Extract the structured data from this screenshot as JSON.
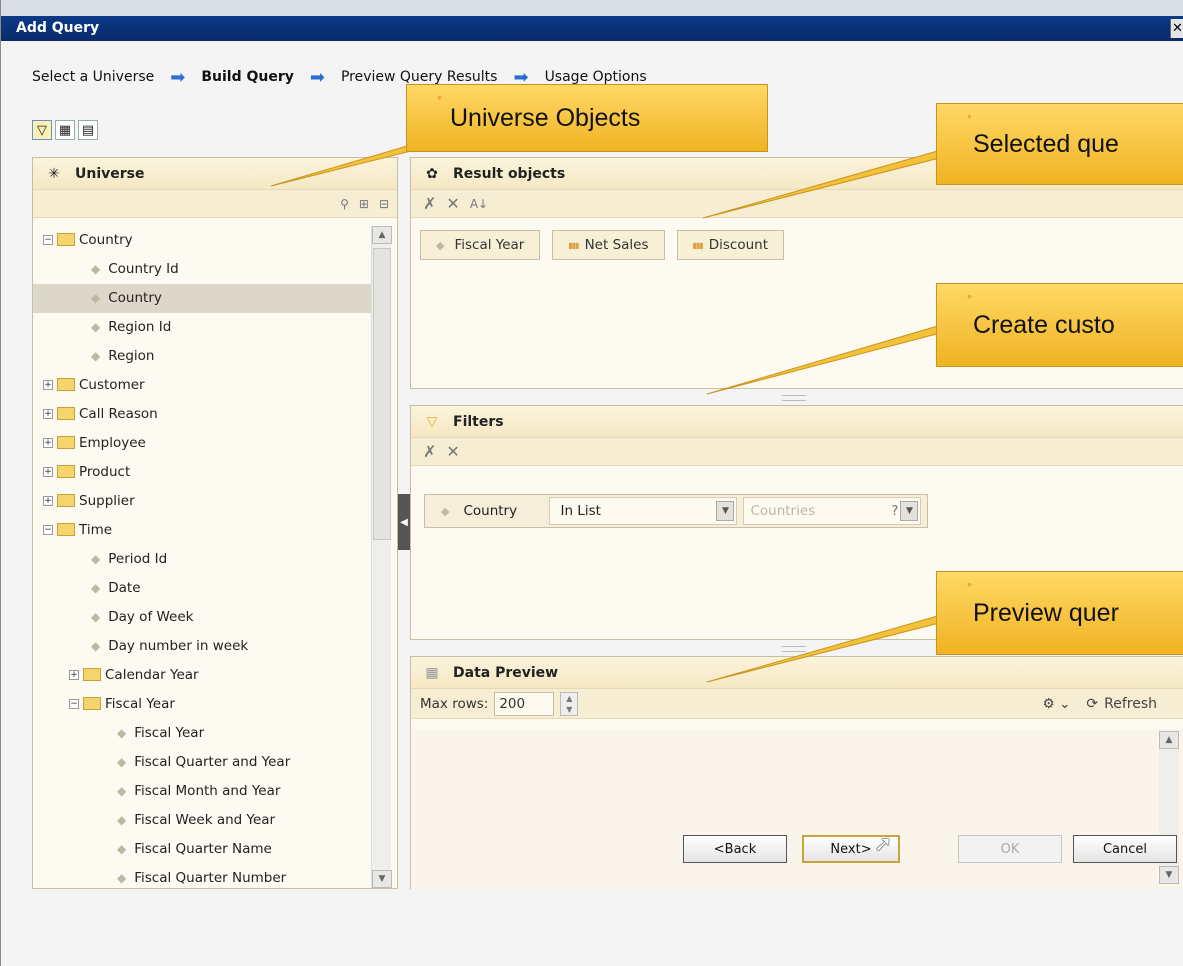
{
  "window": {
    "title": "Add Query",
    "close_label": "✕"
  },
  "wizard": {
    "steps": [
      "Select a Universe",
      "Build Query",
      "Preview Query Results",
      "Usage Options"
    ]
  },
  "universe_panel": {
    "title": "Universe",
    "tree": [
      {
        "label": "Country",
        "type": "folder",
        "expanded": true
      },
      {
        "label": "Country Id",
        "type": "leaf"
      },
      {
        "label": "Country",
        "type": "leaf",
        "selected": true
      },
      {
        "label": "Region Id",
        "type": "leaf"
      },
      {
        "label": "Region",
        "type": "leaf"
      },
      {
        "label": "Customer",
        "type": "folder",
        "expanded": false
      },
      {
        "label": "Call Reason",
        "type": "folder",
        "expanded": false
      },
      {
        "label": "Employee",
        "type": "folder",
        "expanded": false
      },
      {
        "label": "Product",
        "type": "folder",
        "expanded": false
      },
      {
        "label": "Supplier",
        "type": "folder",
        "expanded": false
      },
      {
        "label": "Time",
        "type": "folder",
        "expanded": true
      },
      {
        "label": "Period Id",
        "type": "leaf"
      },
      {
        "label": "Date",
        "type": "leaf"
      },
      {
        "label": "Day of Week",
        "type": "leaf"
      },
      {
        "label": "Day number in week",
        "type": "leaf"
      },
      {
        "label": "Calendar Year",
        "type": "folder",
        "expanded": false
      },
      {
        "label": "Fiscal Year",
        "type": "folder",
        "expanded": true
      },
      {
        "label": "Fiscal Year",
        "type": "leaf"
      },
      {
        "label": "Fiscal Quarter and Year",
        "type": "leaf"
      },
      {
        "label": "Fiscal Month and Year",
        "type": "leaf"
      },
      {
        "label": "Fiscal Week and Year",
        "type": "leaf"
      },
      {
        "label": "Fiscal Quarter Name",
        "type": "leaf"
      },
      {
        "label": "Fiscal Quarter Number",
        "type": "leaf"
      }
    ]
  },
  "results_panel": {
    "title": "Result objects",
    "objects": [
      {
        "label": "Fiscal Year",
        "kind": "dimension"
      },
      {
        "label": "Net Sales",
        "kind": "measure"
      },
      {
        "label": "Discount",
        "kind": "measure"
      }
    ]
  },
  "filters_panel": {
    "title": "Filters",
    "filter": {
      "object": "Country",
      "operator": "In List",
      "value_placeholder": "Countries"
    }
  },
  "preview_panel": {
    "title": "Data Preview",
    "max_rows_label": "Max rows:",
    "max_rows_value": "200",
    "refresh_label": "Refresh"
  },
  "buttons": {
    "back": "<Back",
    "next": "Next>",
    "ok": "OK",
    "cancel": "Cancel"
  },
  "callouts": {
    "universe": "Universe Objects",
    "selected": "Selected que",
    "custom": "Create custo",
    "preview": "Preview quer"
  },
  "colors": {
    "titlebar": "#0a2a6a",
    "callout": "#f0b322",
    "panel_header": "#f5e8c4"
  }
}
